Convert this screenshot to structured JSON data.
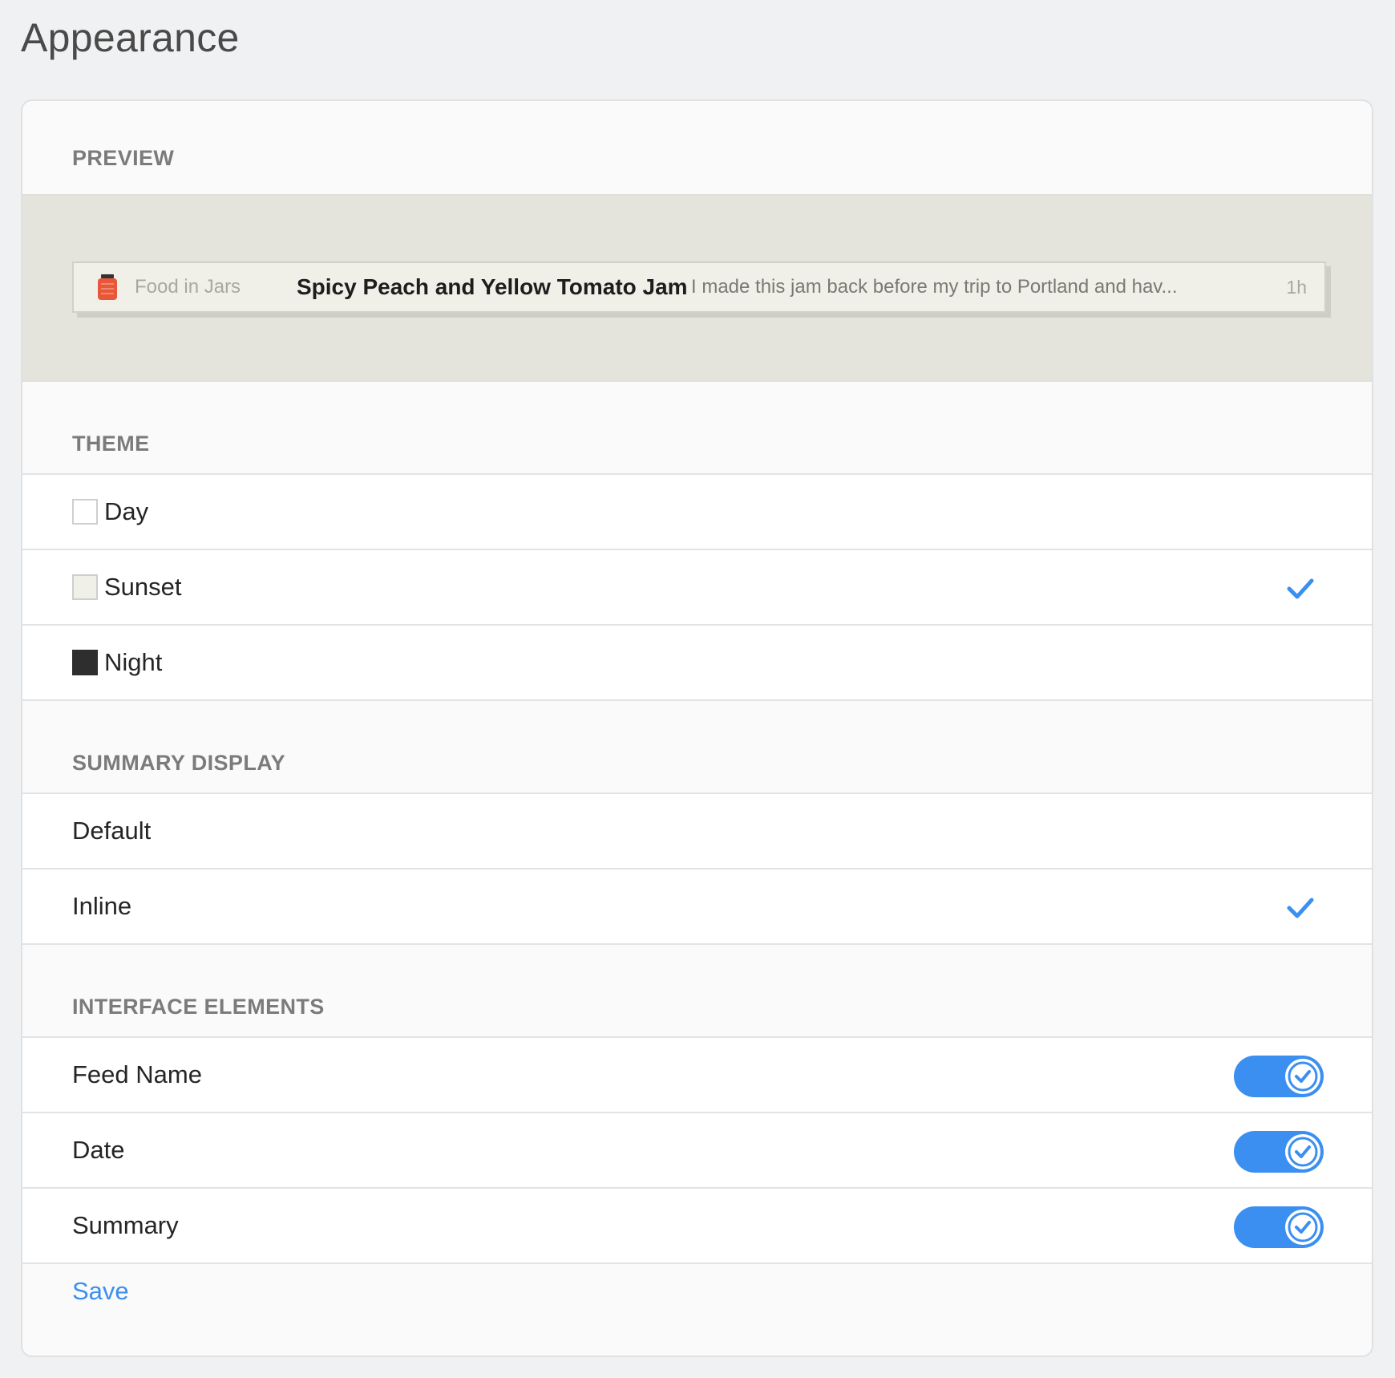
{
  "page_title": "Appearance",
  "preview": {
    "heading": "PREVIEW",
    "feed_name": "Food in Jars",
    "article_title": "Spicy Peach and Yellow Tomato Jam",
    "article_summary": "I made this jam back before my trip to Portland and hav...",
    "time": "1h"
  },
  "theme": {
    "heading": "THEME",
    "options": [
      {
        "label": "Day",
        "swatch_color": "#ffffff",
        "selected": false
      },
      {
        "label": "Sunset",
        "swatch_color": "#f1f0e8",
        "selected": true
      },
      {
        "label": "Night",
        "swatch_color": "#2e2e2e",
        "selected": false
      }
    ]
  },
  "summary_display": {
    "heading": "SUMMARY DISPLAY",
    "options": [
      {
        "label": "Default",
        "selected": false
      },
      {
        "label": "Inline",
        "selected": true
      }
    ]
  },
  "interface_elements": {
    "heading": "INTERFACE ELEMENTS",
    "toggles": [
      {
        "label": "Feed Name",
        "on": true
      },
      {
        "label": "Date",
        "on": true
      },
      {
        "label": "Summary",
        "on": true
      }
    ]
  },
  "save_label": "Save",
  "colors": {
    "accent": "#3a8ff0",
    "preview_background": "#e4e3dc"
  }
}
